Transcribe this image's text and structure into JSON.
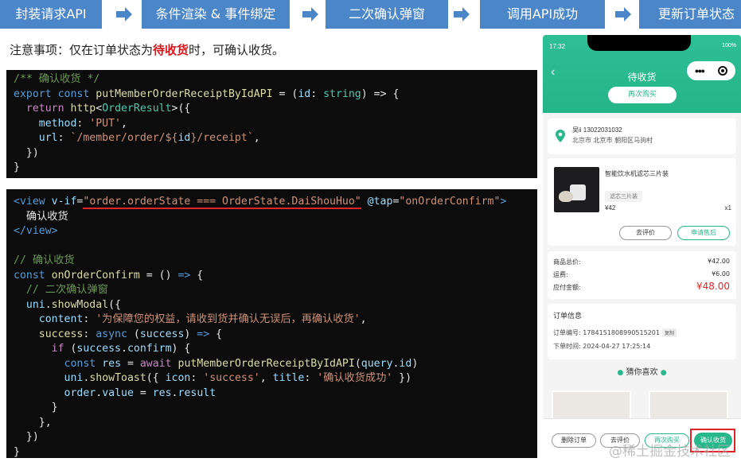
{
  "flow": {
    "steps": [
      "封装请求API",
      "条件渲染 & 事件绑定",
      "二次确认弹窗",
      "调用API成功",
      "更新订单状态"
    ],
    "step_color": "#4a86c8",
    "arrow_icon": "right-arrow-icon"
  },
  "note": {
    "prefix": "注意事项：仅在订单状态为",
    "highlight": "待收货",
    "suffix": "时，可确认收货。",
    "highlight_color": "#d9141a"
  },
  "code1": {
    "line1": "/** 确认收货 */",
    "line2": {
      "a": "export",
      "b": "const",
      "c": "putMemberOrderReceiptByIdAPI",
      "d": " = (",
      "e": "id",
      "f": ": ",
      "g": "string",
      "h": ") => {"
    },
    "line3": {
      "a": "return",
      "b": "http",
      "c": "<",
      "d": "OrderResult",
      "e": ">({"
    },
    "line4": {
      "a": "method",
      "b": ": ",
      "c": "'PUT'",
      "d": ","
    },
    "line5": {
      "a": "url",
      "b": ": ",
      "c": "`/member/order/${",
      "d": "id",
      "e": "}/receipt`",
      "f": ","
    },
    "line6": "})",
    "line7": "}"
  },
  "code2": {
    "tag_open": "<view",
    "attr_if": "v-if",
    "if_expr": "\"order.orderState === OrderState.DaiShouHuo\"",
    "attr_tap": "@tap",
    "tap_val": "\"onOrderConfirm\"",
    "tag_end": ">",
    "text": "确认收货",
    "tag_close": "</view>",
    "comment1": "// 确认收货",
    "fn_decl": {
      "a": "const",
      "b": "onOrderConfirm",
      "c": " = () ",
      "d": "=>",
      "e": " {"
    },
    "comment2": "// 二次确认弹窗",
    "modal": {
      "a": "uni",
      "b": ".",
      "c": "showModal",
      "d": "({"
    },
    "content": {
      "a": "content",
      "b": ": ",
      "c": "'为保障您的权益，请收到货并确认无误后，再确认收货'",
      "d": ","
    },
    "success": {
      "a": "success",
      "b": ": ",
      "c": "async",
      "d": " (",
      "e": "success",
      "f": ") ",
      "g": "=>",
      "h": " {"
    },
    "if_line": {
      "a": "if",
      "b": " (",
      "c": "success",
      "d": ".",
      "e": "confirm",
      "f": ") {"
    },
    "res_line": {
      "a": "const",
      "b": "res",
      "c": " = ",
      "d": "await",
      "e": "putMemberOrderReceiptByIdAPI",
      "f": "(",
      "g": "query",
      "h": ".",
      "i": "id",
      "j": ")"
    },
    "toast_line": {
      "a": "uni",
      "b": ".",
      "c": "showToast",
      "d": "({ ",
      "e": "icon",
      "f": ": ",
      "g": "'success'",
      "h": ", ",
      "i": "title",
      "j": ": ",
      "k": "'确认收货成功'",
      "l": " })"
    },
    "assign_line": {
      "a": "order",
      "b": ".",
      "c": "value",
      "d": " = ",
      "e": "res",
      "f": ".",
      "g": "result"
    },
    "close1": "}",
    "close2": "},",
    "close3": "})",
    "close4": "}"
  },
  "phone": {
    "status_time": "17:32",
    "status_battery": "100%",
    "title": "待收货",
    "rebuy_top": "再次购买",
    "address": {
      "name_phone": "吴ii 13022031032",
      "line": "北京市 北京市 朝阳区马驹村"
    },
    "goods": {
      "name": "智能饮水机滤芯三片装",
      "spec": "滤芯三片装",
      "price": "¥42",
      "qty": "x1",
      "btn_review": "去评价",
      "btn_after_sale": "申请售后"
    },
    "price_rows": [
      {
        "label": "商品总价:",
        "value": "¥42.00"
      },
      {
        "label": "运费:",
        "value": "¥6.00"
      },
      {
        "label": "应付金额:",
        "value": "¥48.00"
      }
    ],
    "info": {
      "title": "订单信息",
      "order_no": "订单编号: 1784151808990515201",
      "copy": "复制",
      "order_time": "下单时间: 2024-04-27 17:25:14"
    },
    "guess": "猜你喜欢",
    "bottom": {
      "delete": "删除订单",
      "review": "去评价",
      "rebuy": "再次购买",
      "confirm": "确认收货"
    },
    "theme_color": "#27b78a"
  },
  "watermark": "@稀土掘金技术社区"
}
